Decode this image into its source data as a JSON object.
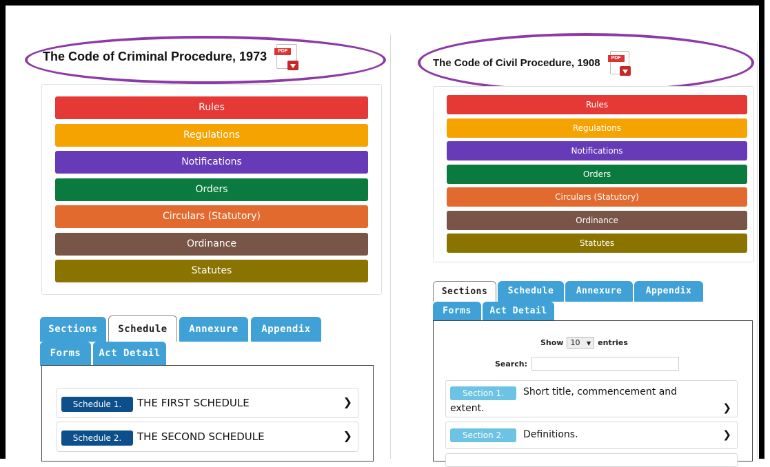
{
  "left": {
    "title": "The Code of Criminal Procedure, 1973",
    "pdf_icon": "pdf-download-icon",
    "categories": [
      {
        "label": "Rules",
        "color": "#e53935"
      },
      {
        "label": "Regulations",
        "color": "#f5a300"
      },
      {
        "label": "Notifications",
        "color": "#673ab7"
      },
      {
        "label": "Orders",
        "color": "#0b7a3e"
      },
      {
        "label": "Circulars (Statutory)",
        "color": "#e36a2e"
      },
      {
        "label": "Ordinance",
        "color": "#795548"
      },
      {
        "label": "Statutes",
        "color": "#8b7300"
      }
    ],
    "tabs": [
      "Sections",
      "Schedule",
      "Annexure",
      "Appendix",
      "Forms",
      "Act Detail"
    ],
    "active_tab": "Schedule",
    "rows": [
      {
        "badge": "Schedule 1.",
        "text": "THE FIRST SCHEDULE"
      },
      {
        "badge": "Schedule 2.",
        "text": "THE SECOND SCHEDULE"
      }
    ]
  },
  "right": {
    "title": "The Code of Civil Procedure, 1908",
    "pdf_icon": "pdf-download-icon",
    "categories": [
      {
        "label": "Rules",
        "color": "#e53935"
      },
      {
        "label": "Regulations",
        "color": "#f5a300"
      },
      {
        "label": "Notifications",
        "color": "#673ab7"
      },
      {
        "label": "Orders",
        "color": "#0b7a3e"
      },
      {
        "label": "Circulars (Statutory)",
        "color": "#e36a2e"
      },
      {
        "label": "Ordinance",
        "color": "#795548"
      },
      {
        "label": "Statutes",
        "color": "#8b7300"
      }
    ],
    "tabs": [
      "Sections",
      "Schedule",
      "Annexure",
      "Appendix",
      "Forms",
      "Act Detail"
    ],
    "active_tab": "Sections",
    "show_label": "Show",
    "entries_value": "10",
    "entries_label": "entries",
    "search_label": "Search:",
    "search_value": "",
    "rows": [
      {
        "badge": "Section 1.",
        "text_line1": "Short title, commencement and",
        "text_line2": "extent."
      },
      {
        "badge": "Section 2.",
        "text_line1": "Definitions."
      }
    ]
  },
  "colors": {
    "tab_blue": "#3fa1d6",
    "schedule_badge": "#0d4f8b",
    "section_badge": "#6cc3e3",
    "oval": "#8e3aa6"
  }
}
